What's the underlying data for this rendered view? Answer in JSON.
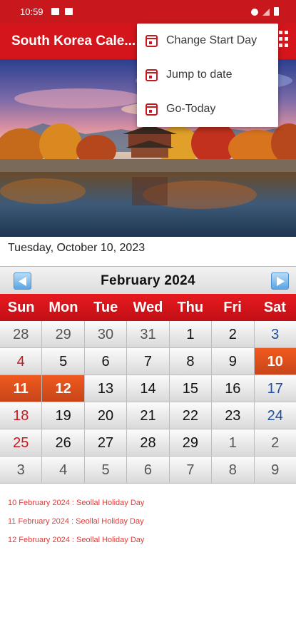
{
  "status": {
    "time": "10:59"
  },
  "app": {
    "title": "South Korea Cale..."
  },
  "menu": {
    "items": [
      {
        "label": "Change Start Day",
        "icon": "calendar-icon"
      },
      {
        "label": "Jump to date",
        "icon": "calendar-icon"
      },
      {
        "label": "Go-Today",
        "icon": "calendar-icon"
      }
    ]
  },
  "current_date": "Tuesday, October 10, 2023",
  "calendar": {
    "month_title": "February  2024",
    "days": [
      "Sun",
      "Mon",
      "Tue",
      "Wed",
      "Thu",
      "Fri",
      "Sat"
    ],
    "weeks": [
      [
        "28",
        "29",
        "30",
        "31",
        "1",
        "2",
        "3"
      ],
      [
        "4",
        "5",
        "6",
        "7",
        "8",
        "9",
        "10"
      ],
      [
        "11",
        "12",
        "13",
        "14",
        "15",
        "16",
        "17"
      ],
      [
        "18",
        "19",
        "20",
        "21",
        "22",
        "23",
        "24"
      ],
      [
        "25",
        "26",
        "27",
        "28",
        "29",
        "1",
        "2"
      ],
      [
        "3",
        "4",
        "5",
        "6",
        "7",
        "8",
        "9"
      ]
    ]
  },
  "events": [
    "10 February 2024 : Seollal Holiday Day",
    "11 February 2024 : Seollal Holiday Day",
    "12 February 2024 : Seollal Holiday Day"
  ],
  "colors": {
    "appbar": "#d4161c",
    "holiday": "#f05a1e",
    "sunday": "#c8181e",
    "saturday": "#1f4f9f",
    "event_text": "#e23b3b"
  }
}
